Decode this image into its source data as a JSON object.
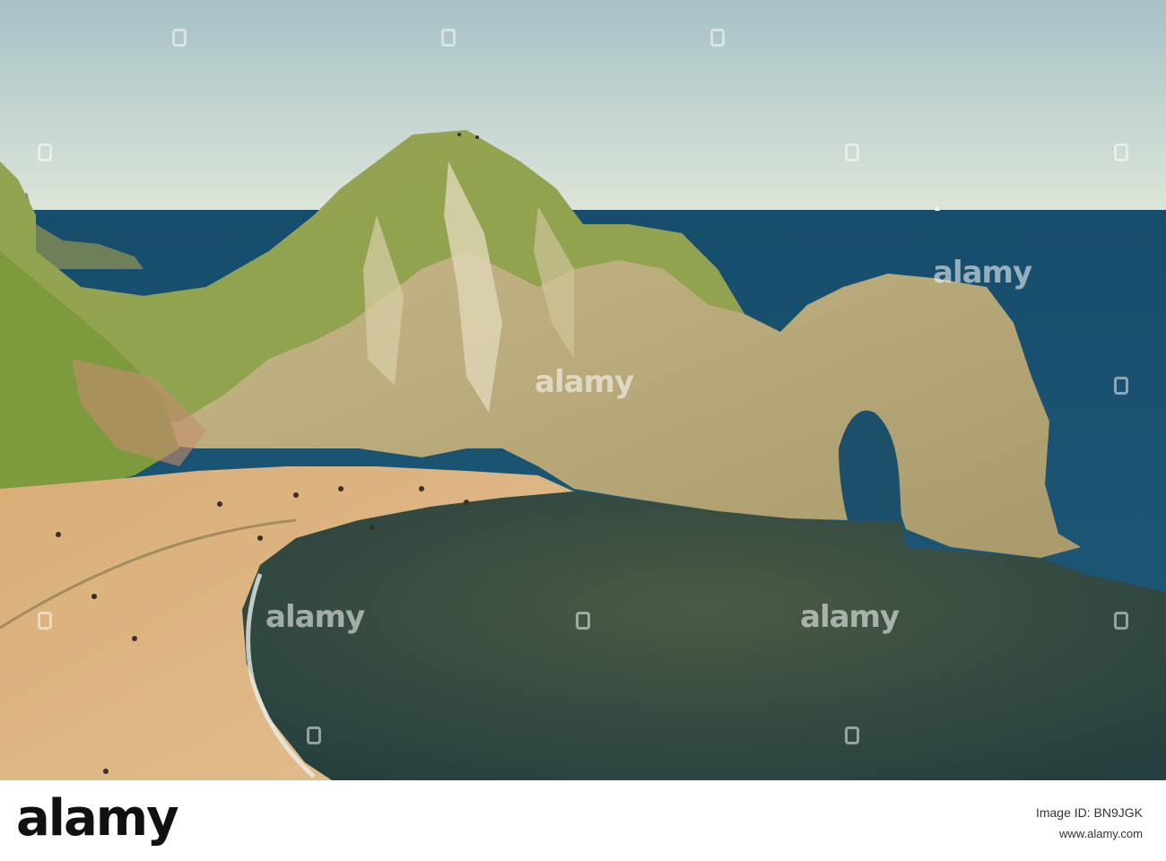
{
  "watermark": {
    "text": "alamy"
  },
  "footer": {
    "logo_text": "alamy",
    "image_id_text": "Image ID: BN9JGK",
    "site_text": "www.alamy.com"
  },
  "colors": {
    "sky_top": "#a9c3c6",
    "sky_horizon": "#dfe6d9",
    "sea": "#16506e",
    "cove_water": "#3a4a3e",
    "sand": "#d9b27c",
    "cliff_grass": "#8aa24a",
    "limestone": "#c9b98a"
  }
}
